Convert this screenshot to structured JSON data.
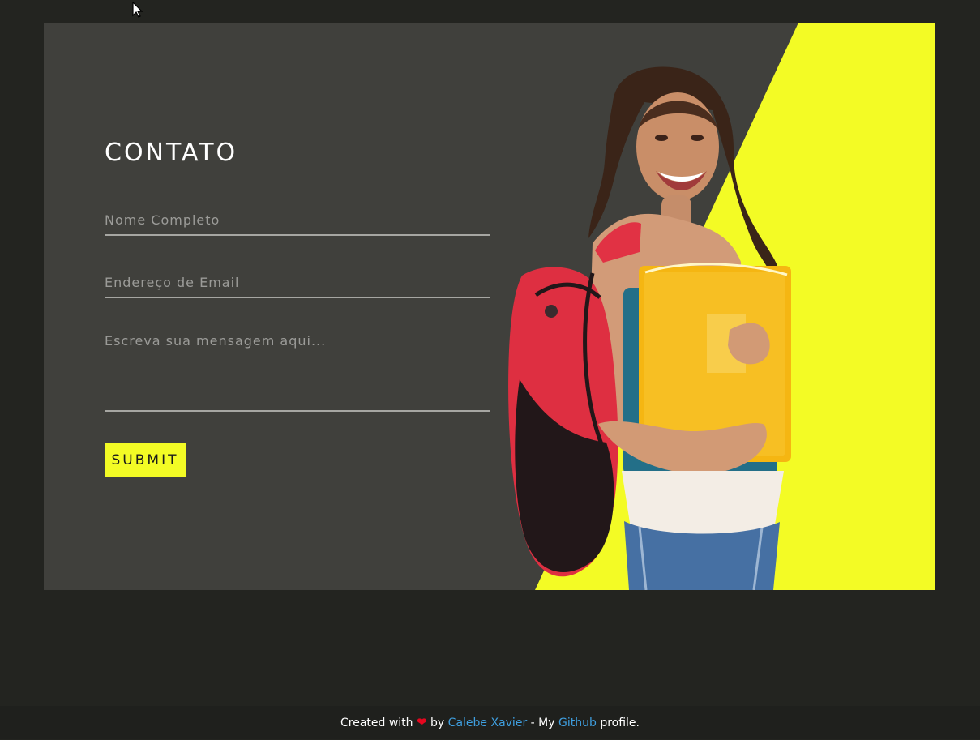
{
  "contact": {
    "title": "CONTATO",
    "name_placeholder": "Nome Completo",
    "email_placeholder": "Endereço de Email",
    "message_placeholder": "Escreva sua mensagem aqui...",
    "submit_label": "SUBMIT"
  },
  "footer": {
    "created_with": "Created with",
    "heart_icon": "❤",
    "by": "by",
    "author": "Calebe Xavier",
    "separator": "- My",
    "github": "Github",
    "profile": "profile."
  },
  "colors": {
    "page_background": "#232420",
    "card_background": "#40403c",
    "accent_yellow": "#f3fb25",
    "link_blue": "#3f9fe0",
    "heart_red": "#e5071f"
  },
  "icons": {
    "cursor": "mouse-pointer-icon",
    "heart": "heart-icon"
  }
}
